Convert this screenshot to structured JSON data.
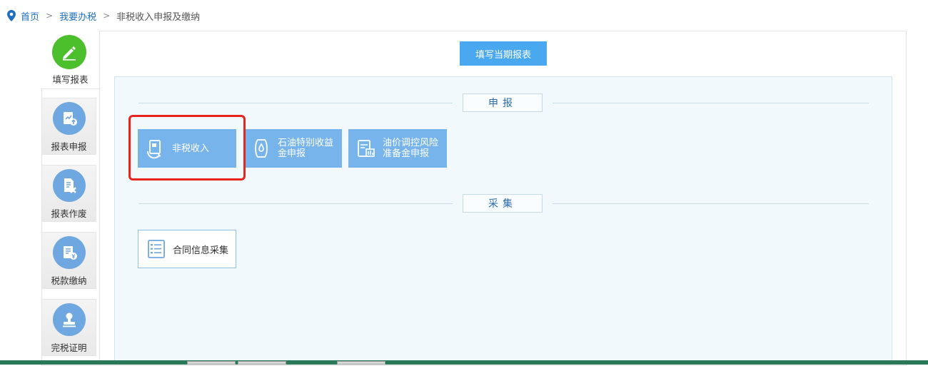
{
  "breadcrumb": {
    "home": "首页",
    "sep1": ">",
    "level2": "我要办税",
    "sep2": ">",
    "current": "非税收入申报及缴纳"
  },
  "sidebar": {
    "active": {
      "label": "填写报表",
      "icon": "pencil-icon"
    },
    "items": [
      {
        "label": "报表申报",
        "icon": "report-upload-icon"
      },
      {
        "label": "报表作废",
        "icon": "report-cancel-icon"
      },
      {
        "label": "税款缴纳",
        "icon": "tax-payment-icon"
      },
      {
        "label": "完税证明",
        "icon": "stamp-icon"
      }
    ]
  },
  "main": {
    "fill_button": "填写当期报表",
    "sections": {
      "declare": {
        "title": "申报",
        "tiles": [
          {
            "label": "非税收入",
            "icon": "document-refresh-icon"
          },
          {
            "label_line1": "石油特别收益",
            "label_line2": "金申报",
            "icon": "oil-barrel-icon"
          },
          {
            "label_line1": "油价调控风险",
            "label_line2": "准备金申报",
            "icon": "chart-doc-icon"
          }
        ]
      },
      "collect": {
        "title": "采集",
        "tiles": [
          {
            "label": "合同信息采集",
            "icon": "list-document-icon"
          }
        ]
      }
    }
  },
  "colors": {
    "accent_green": "#4cbf2d",
    "tile_blue": "#77b4ec",
    "button_blue": "#4aa8f0",
    "highlight_red": "#e8241e"
  }
}
